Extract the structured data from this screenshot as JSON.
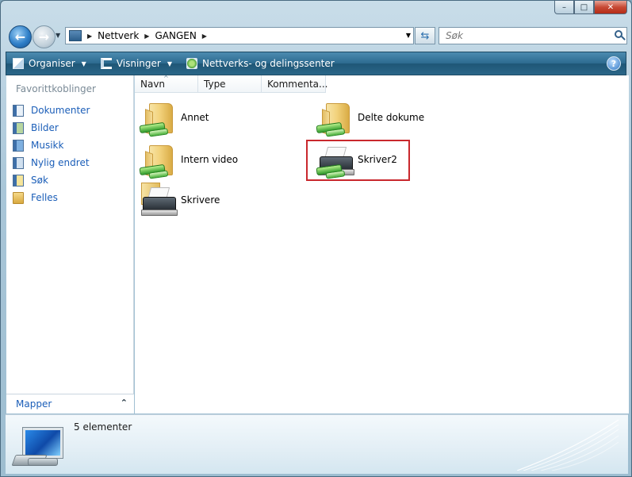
{
  "window": {
    "caption": {
      "minimize": "–",
      "maximize": "□",
      "close": "✕"
    }
  },
  "address": {
    "crumbs": [
      "Nettverk",
      "GANGEN"
    ],
    "search_placeholder": "Søk"
  },
  "toolbar": {
    "organize": "Organiser",
    "views": "Visninger",
    "network_center": "Nettverks- og delingssenter",
    "help": "?"
  },
  "nav": {
    "heading": "Favorittkoblinger",
    "items": [
      {
        "label": "Dokumenter",
        "icon": "documents-icon"
      },
      {
        "label": "Bilder",
        "icon": "pictures-icon"
      },
      {
        "label": "Musikk",
        "icon": "music-icon"
      },
      {
        "label": "Nylig endret",
        "icon": "recently-changed-icon"
      },
      {
        "label": "Søk",
        "icon": "searches-icon"
      },
      {
        "label": "Felles",
        "icon": "public-folder-icon"
      }
    ],
    "folders_label": "Mapper"
  },
  "columns": [
    "Navn",
    "Type",
    "Kommenta..."
  ],
  "items": [
    {
      "label": "Annet",
      "kind": "shared-folder"
    },
    {
      "label": "Delte dokume",
      "kind": "shared-folder"
    },
    {
      "label": "Intern video",
      "kind": "shared-folder"
    },
    {
      "label": "Skriver2",
      "kind": "shared-printer",
      "selected": true
    },
    {
      "label": "Skrivere",
      "kind": "printers-folder"
    }
  ],
  "details": {
    "count": "5 elementer"
  },
  "colors": {
    "link": "#1b5eb8",
    "selection_border": "#c9282d",
    "toolbar": "#2c6a8f"
  }
}
